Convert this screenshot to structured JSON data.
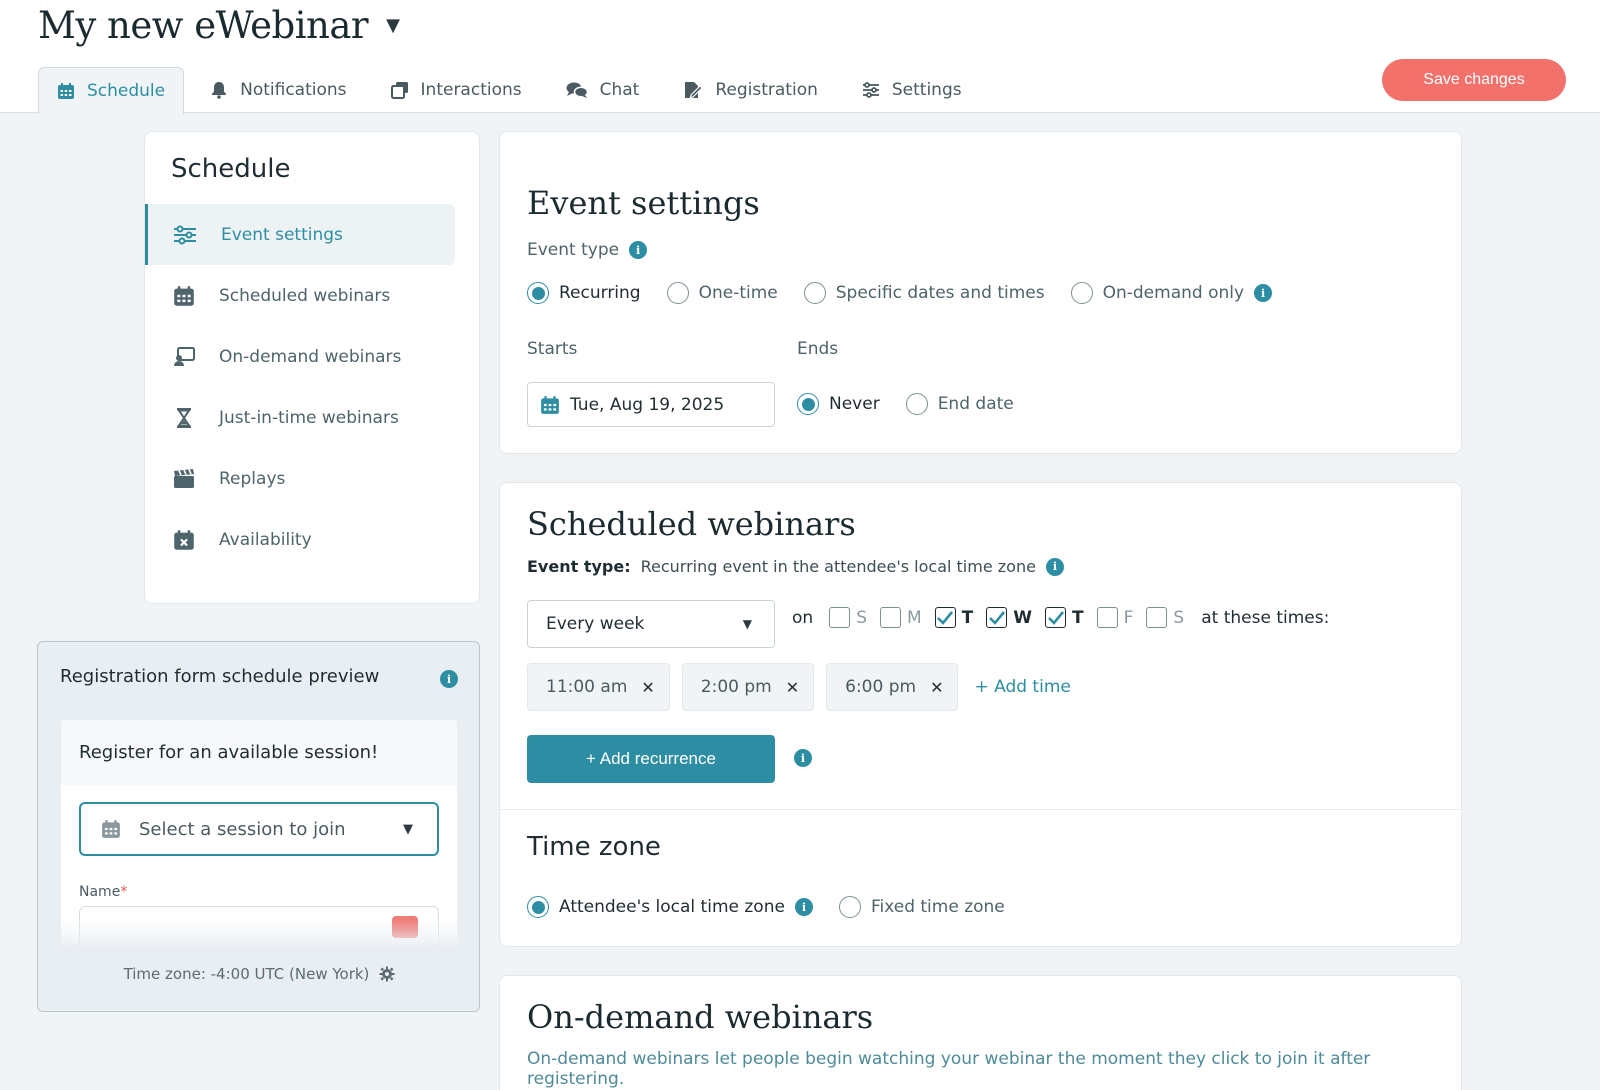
{
  "app": {
    "title": "My new eWebinar"
  },
  "tabs": [
    {
      "label": "Schedule",
      "icon": "calendar-icon",
      "active": true
    },
    {
      "label": "Notifications",
      "icon": "bell-icon"
    },
    {
      "label": "Interactions",
      "icon": "cards-icon"
    },
    {
      "label": "Chat",
      "icon": "chat-icon"
    },
    {
      "label": "Registration",
      "icon": "form-icon"
    },
    {
      "label": "Settings",
      "icon": "sliders-icon"
    }
  ],
  "save_label": "Save changes",
  "sidebar": {
    "title": "Schedule",
    "items": [
      {
        "label": "Event settings",
        "icon": "sliders-icon",
        "active": true
      },
      {
        "label": "Scheduled webinars",
        "icon": "calendar-icon"
      },
      {
        "label": "On-demand webinars",
        "icon": "screen-user-icon"
      },
      {
        "label": "Just-in-time webinars",
        "icon": "hourglass-icon"
      },
      {
        "label": "Replays",
        "icon": "clapper-icon"
      },
      {
        "label": "Availability",
        "icon": "calendar-x-icon"
      }
    ]
  },
  "preview": {
    "title": "Registration form schedule preview",
    "heading": "Register for an available session!",
    "select_placeholder": "Select a session to join",
    "name_label": "Name",
    "required_mark": "*",
    "timezone": "Time zone: -4:00 UTC (New York)"
  },
  "event_settings": {
    "title": "Event settings",
    "event_type_label": "Event type",
    "types": [
      "Recurring",
      "One-time",
      "Specific dates and times",
      "On-demand only"
    ],
    "selected_type": "Recurring",
    "starts_label": "Starts",
    "start_date": "Tue, Aug 19, 2025",
    "ends_label": "Ends",
    "end_options": [
      "Never",
      "End date"
    ],
    "selected_end": "Never"
  },
  "scheduled": {
    "title": "Scheduled webinars",
    "event_type_prefix": "Event type:",
    "event_type_value": "Recurring event in the attendee's local time zone",
    "frequency": "Every week",
    "on_label": "on",
    "days": [
      {
        "label": "S",
        "checked": false
      },
      {
        "label": "M",
        "checked": false
      },
      {
        "label": "T",
        "checked": true
      },
      {
        "label": "W",
        "checked": true
      },
      {
        "label": "T",
        "checked": true
      },
      {
        "label": "F",
        "checked": false
      },
      {
        "label": "S",
        "checked": false
      }
    ],
    "times_label": "at these times:",
    "times": [
      "11:00 am",
      "2:00 pm",
      "6:00 pm"
    ],
    "add_time": "+ Add time",
    "add_recurrence": "+ Add recurrence"
  },
  "timezone": {
    "title": "Time zone",
    "options": [
      "Attendee's local time zone",
      "Fixed time zone"
    ],
    "selected": "Attendee's local time zone"
  },
  "on_demand": {
    "title": "On-demand webinars",
    "description": "On-demand webinars let people begin watching your webinar the moment they click to join it after registering."
  },
  "colors": {
    "accent": "#2d8ea3",
    "save": "#f2716b",
    "background": "#f1f4f6"
  }
}
